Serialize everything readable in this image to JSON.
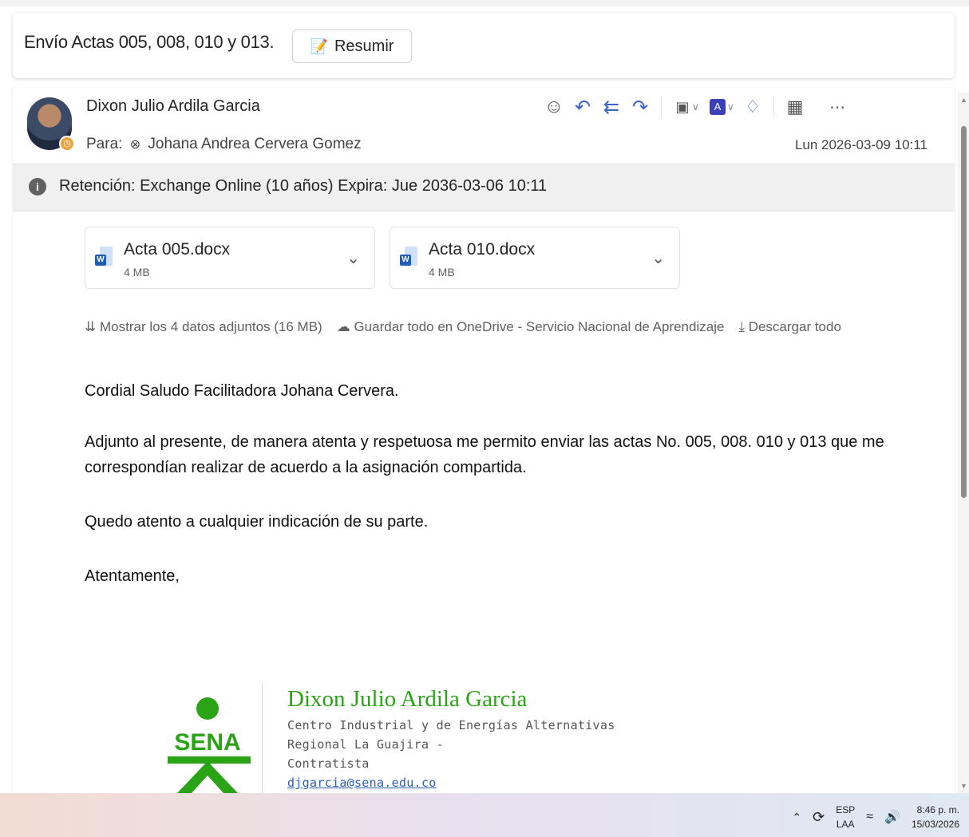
{
  "subject": {
    "title": "Envío Actas 005, 008, 010 y 013.",
    "summarize_label": "Resumir"
  },
  "message": {
    "sender": "Dixon Julio Ardila Garcia",
    "to_prefix": "Para:",
    "recipient": "Johana Andrea Cervera Gomez",
    "date": "Lun 2026-03-09 10:11",
    "retention": "Retención: Exchange Online (10 años) Expira: Jue 2036-03-06 10:11"
  },
  "attachments": [
    {
      "name": "Acta 005.docx",
      "size": "4 MB"
    },
    {
      "name": "Acta 010.docx",
      "size": "4 MB"
    }
  ],
  "attachment_actions": {
    "show_all": "Mostrar los 4 datos adjuntos (16 MB)",
    "save_onedrive": "Guardar todo en OneDrive - Servicio Nacional de Aprendizaje",
    "download_all": "Descargar todo"
  },
  "body": {
    "greeting": "Cordial Saludo Facilitadora Johana Cervera.",
    "paragraph": "Adjunto al presente, de manera atenta y respetuosa me permito enviar las actas No. 005, 008. 010 y 013 que me correspondían realizar de acuerdo a la asignación compartida.",
    "closing_line": "Quedo atento a cualquier indicación de su parte.",
    "sign_off": "Atentamente,"
  },
  "signature": {
    "name": "Dixon Julio Ardila Garcia",
    "center": "Centro Industrial y de Energías Alternativas",
    "regional": "Regional La Guajira -",
    "role": "Contratista",
    "email": "djgarcia@sena.edu.co",
    "logo_text": "SENA"
  },
  "taskbar": {
    "lang_top": "ESP",
    "lang_bottom": "LAA",
    "time": "8:46 p. m.",
    "date": "15/03/2026"
  },
  "colors": {
    "accent": "#3a62c7",
    "sena_green": "#2aa317",
    "link": "#2b5fb7"
  }
}
